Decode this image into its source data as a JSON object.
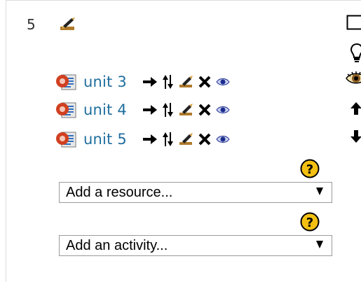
{
  "section": {
    "number": "5"
  },
  "resources": [
    {
      "label": "unit 3"
    },
    {
      "label": "unit 4"
    },
    {
      "label": "unit 5"
    }
  ],
  "add_resource": {
    "selected": "Add a resource..."
  },
  "add_activity": {
    "selected": "Add an activity..."
  },
  "colors": {
    "link": "#1f6e9e",
    "help": "#f3c012",
    "eye": "#1b2c8c"
  }
}
